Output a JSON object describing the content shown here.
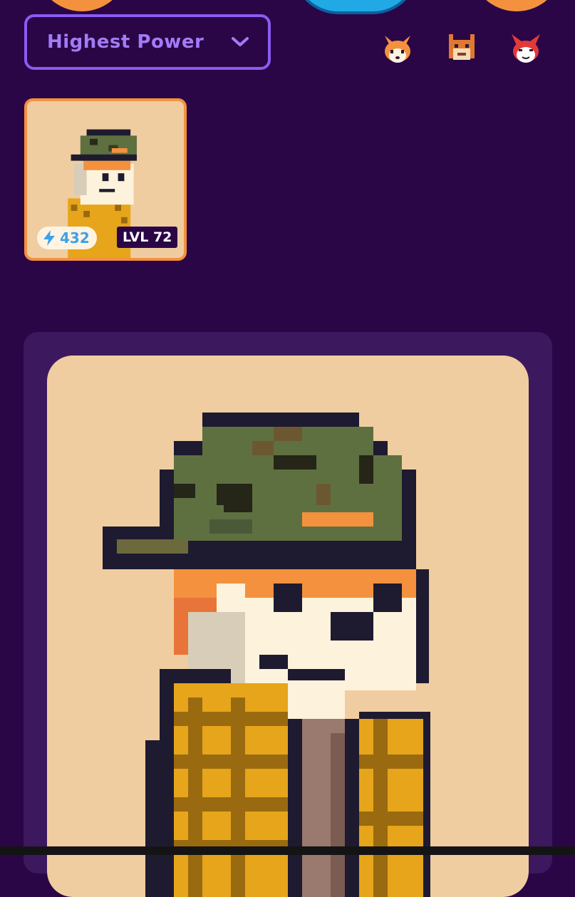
{
  "sort": {
    "selected": "Highest Power"
  },
  "filters": [
    {
      "icon": "fox-head-icon"
    },
    {
      "icon": "pixel-fox-icon"
    },
    {
      "icon": "red-fox-icon"
    }
  ],
  "cards": [
    {
      "power": "432",
      "level_label": "LVL",
      "level": "72"
    }
  ],
  "colors": {
    "background": "#2a0646",
    "panel": "#3c195e",
    "accent": "#8a5cf0",
    "card_border": "#f4913e",
    "card_bg": "#f0cda0",
    "power_blue": "#3fa1e8"
  }
}
